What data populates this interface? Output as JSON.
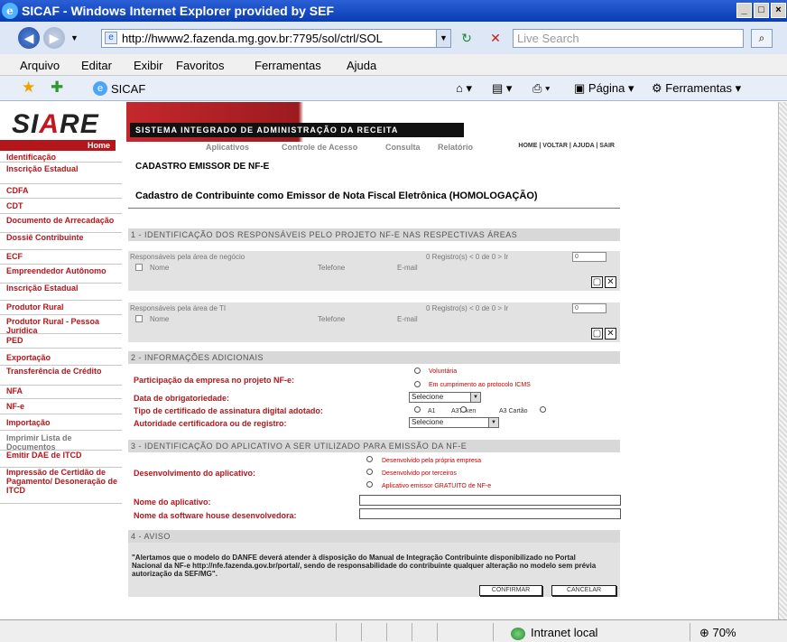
{
  "window": {
    "title": "SICAF - Windows Internet Explorer provided by SEF",
    "min": "_",
    "max": "□",
    "close": "×"
  },
  "address": {
    "url": "http://hwww2.fazenda.mg.gov.br:7795/sol/ctrl/SOL",
    "search_placeholder": "Live Search"
  },
  "menu": [
    "Arquivo",
    "Editar",
    "Exibir",
    "Favoritos",
    "Ferramentas",
    "Ajuda"
  ],
  "toolbar": {
    "tab_label": "SICAF",
    "page": "Página",
    "tools": "Ferramentas"
  },
  "sidebar": {
    "logo_left": "SI",
    "logo_mid": "A",
    "logo_right": "RE",
    "home": "Home",
    "items": [
      "Identificação",
      "Inscrição Estadual",
      "CDFA",
      "CDT",
      "Documento de Arrecadação",
      "Dossiê Contribuinte",
      "ECF",
      "Empreendedor Autônomo",
      "Inscrição Estadual",
      "Produtor Rural",
      "Produtor Rural - Pessoa Jurídica",
      "PED",
      "Exportação",
      "Transferência de Crédito",
      "NFA",
      "NF-e",
      "Importação",
      "Imprimir Lista de Documentos",
      "Emitir DAE de ITCD",
      "Impressão de Certidão de Pagamento/ Desoneração de ITCD"
    ]
  },
  "banner": {
    "system": "SISTEMA INTEGRADO DE ADMINISTRAÇÃO DA RECEITA",
    "nav": [
      "Aplicativos",
      "Controle de Acesso",
      "Consulta",
      "Relatório"
    ],
    "right": "HOME | VOLTAR | AJUDA | SAIR"
  },
  "page": {
    "title": "CADASTRO EMISSOR DE NF-E",
    "subtitle": "Cadastro de Contribuinte como Emissor de Nota Fiscal Eletrônica (HOMOLOGAÇÃO)"
  },
  "s1": {
    "header": "1 - IDENTIFICAÇÃO DOS RESPONSÁVEIS PELO PROJETO NF-E NAS RESPECTIVAS ÁREAS",
    "g1": {
      "title": "Responsáveis pela área de negócio",
      "pager": "0 Registro(s) < 0 de 0 > Ir",
      "page": "0",
      "cols": [
        "Nome",
        "Telefone",
        "E-mail"
      ]
    },
    "g2": {
      "title": "Responsáveis pela área de TI",
      "pager": "0 Registro(s) < 0 de 0 > Ir",
      "page": "0",
      "cols": [
        "Nome",
        "Telefone",
        "E-mail"
      ]
    }
  },
  "s2": {
    "header": "2 - INFORMAÇÕES ADICIONAIS",
    "q1": "Participação da empresa no projeto NF-e:",
    "q1_opts": [
      "Voluntária",
      "Em cumprimento ao protocolo ICMS"
    ],
    "q2": "Data de obrigatoriedade:",
    "q2_val": "Selecione",
    "q3": "Tipo de certificado de assinatura digital adotado:",
    "q3_opts": [
      "A1",
      "A3Token",
      "A3 Cartão"
    ],
    "q4": "Autoridade certificadora ou de registro:",
    "q4_val": "Selecione"
  },
  "s3": {
    "header": "3 - IDENTIFICAÇÃO DO APLICATIVO A SER UTILIZADO PARA EMISSÃO DA NF-E",
    "q1": "Desenvolvimento do aplicativo:",
    "opts": [
      "Desenvolvido pela própria empresa",
      "Desenvolvido por terceiros",
      "Aplicativo emissor GRATUITO de NF-e"
    ],
    "q2": "Nome do aplicativo:",
    "q3": "Nome da software house desenvolvedora:"
  },
  "s4": {
    "header": "4 - AVISO",
    "msg": "\"Alertamos que o modelo do DANFE deverá atender à disposição do Manual de Integração Contribuinte disponibilizado no Portal Nacional da NF-e http://nfe.fazenda.gov.br/portal/, sendo de responsabilidade do contribuinte qualquer alteração no modelo sem prévia autorização da SEF/MG\".",
    "confirm": "CONFIRMAR",
    "cancel": "CANCELAR"
  },
  "status": {
    "zone": "Intranet local",
    "zoom": "70%"
  }
}
